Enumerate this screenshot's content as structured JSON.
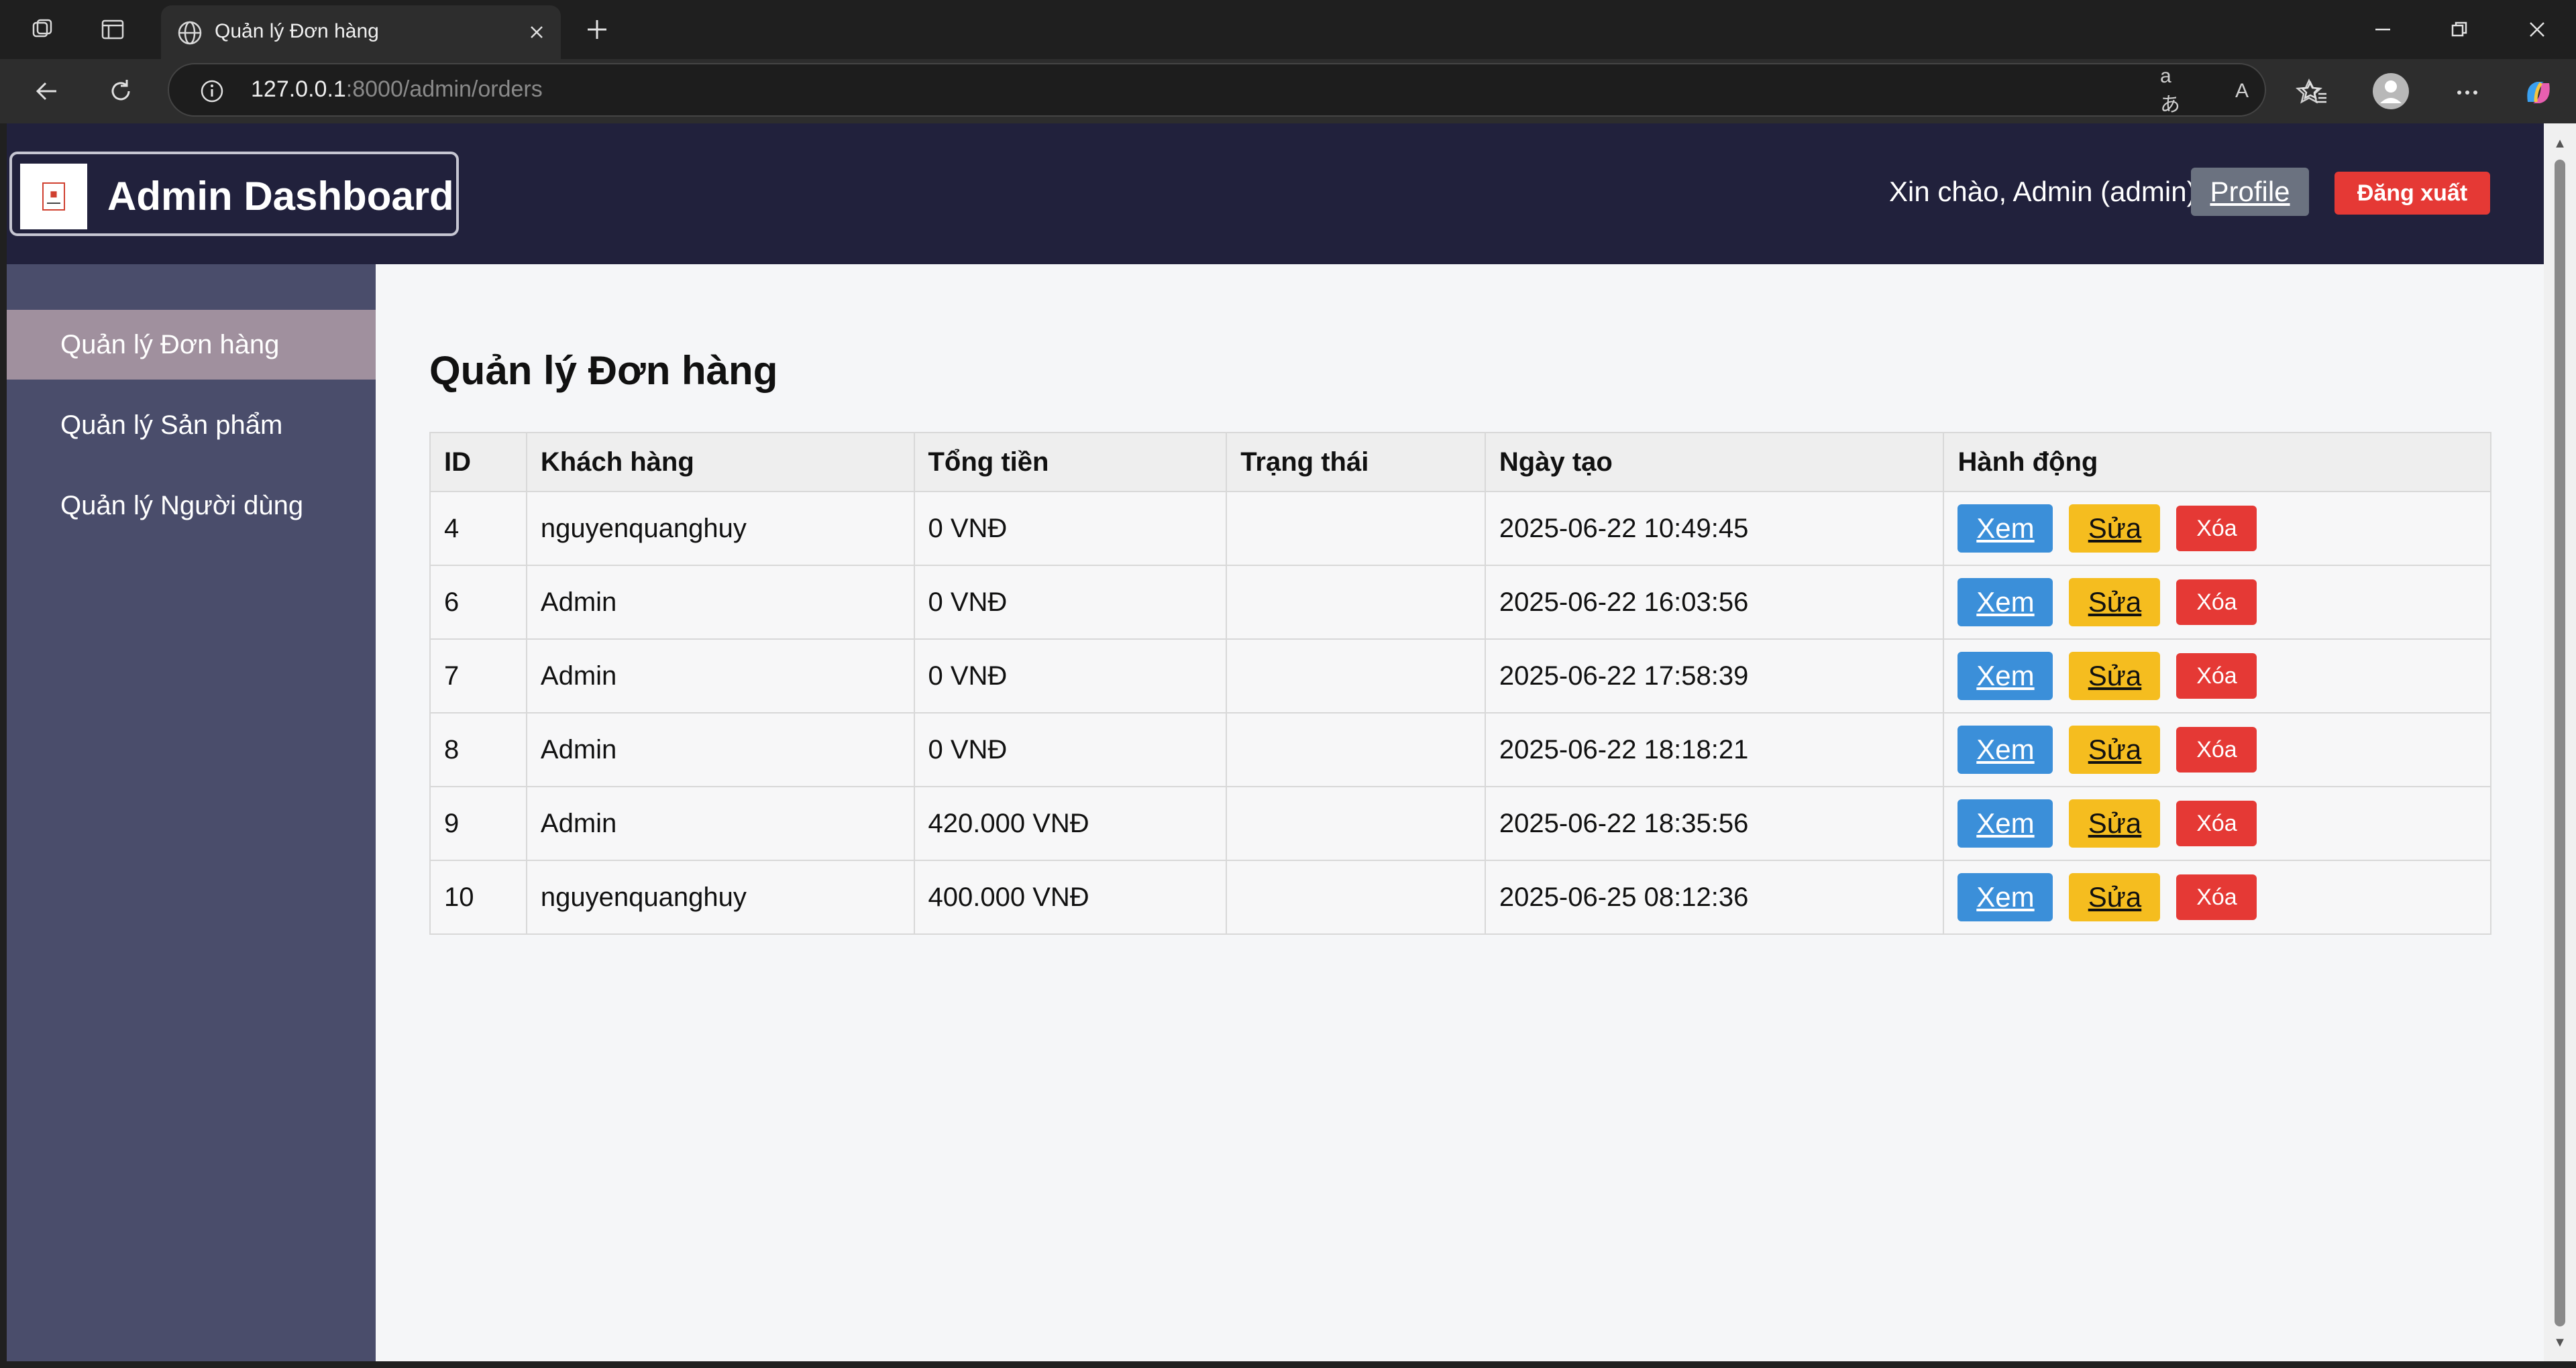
{
  "browser": {
    "tab_title": "Quản lý Đơn hàng",
    "url_host": "127.0.0.1",
    "url_rest": ":8000/admin/orders"
  },
  "header": {
    "brand": "Admin Dashboard",
    "greeting": "Xin chào, Admin (admin)",
    "profile_label": "Profile",
    "logout_label": "Đăng xuất"
  },
  "sidebar": {
    "items": [
      {
        "label": "Quản lý Đơn hàng",
        "active": true
      },
      {
        "label": "Quản lý Sản phẩm",
        "active": false
      },
      {
        "label": "Quản lý Người dùng",
        "active": false
      }
    ]
  },
  "main": {
    "title": "Quản lý Đơn hàng",
    "columns": [
      "ID",
      "Khách hàng",
      "Tổng tiền",
      "Trạng thái",
      "Ngày tạo",
      "Hành động"
    ],
    "rows": [
      {
        "id": "4",
        "customer": "nguyenquanghuy",
        "total": "0 VNĐ",
        "status": "",
        "created": "2025-06-22 10:49:45"
      },
      {
        "id": "6",
        "customer": "Admin",
        "total": "0 VNĐ",
        "status": "",
        "created": "2025-06-22 16:03:56"
      },
      {
        "id": "7",
        "customer": "Admin",
        "total": "0 VNĐ",
        "status": "",
        "created": "2025-06-22 17:58:39"
      },
      {
        "id": "8",
        "customer": "Admin",
        "total": "0 VNĐ",
        "status": "",
        "created": "2025-06-22 18:18:21"
      },
      {
        "id": "9",
        "customer": "Admin",
        "total": "420.000 VNĐ",
        "status": "",
        "created": "2025-06-22 18:35:56"
      },
      {
        "id": "10",
        "customer": "nguyenquanghuy",
        "total": "400.000 VNĐ",
        "status": "",
        "created": "2025-06-25 08:12:36"
      }
    ],
    "actions": {
      "view": "Xem",
      "edit": "Sửa",
      "delete": "Xóa"
    }
  },
  "colors": {
    "header_bg": "#21213c",
    "sidebar_bg": "#4a4d6b",
    "sidebar_active": "#a0909e",
    "view_btn": "#3b8fd9",
    "edit_btn": "#f5bd1f",
    "delete_btn": "#e53935",
    "profile_btn": "#6b7280"
  }
}
